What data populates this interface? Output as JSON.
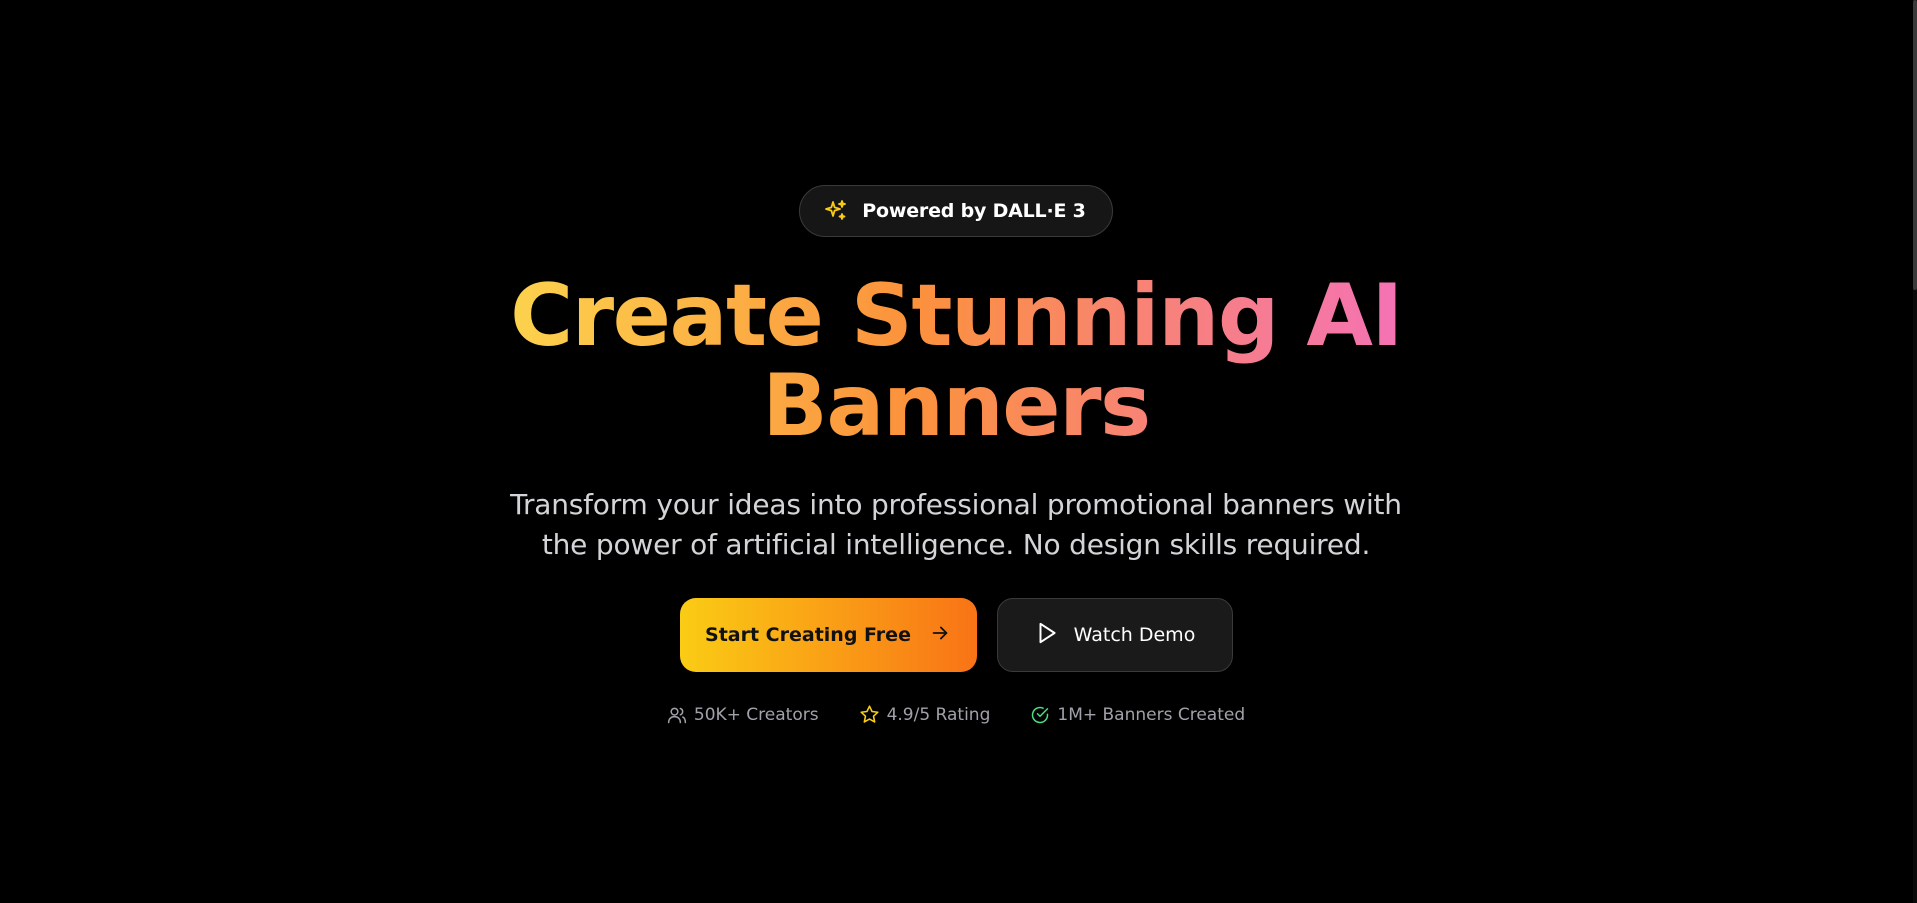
{
  "badge": {
    "icon": "sparkles-icon",
    "text": "Powered by DALL·E 3",
    "icon_color": "#facc15"
  },
  "hero": {
    "headline": "Create Stunning AI Banners",
    "subtitle": "Transform your ideas into professional promotional banners with the power of artificial intelligence. No design skills required.",
    "gradient": [
      "#fcd34d",
      "#fb923c",
      "#f472b6"
    ]
  },
  "cta": {
    "primary_label": "Start Creating Free",
    "primary_icon": "arrow-right-icon",
    "secondary_label": "Watch Demo",
    "secondary_icon": "play-icon"
  },
  "stats": [
    {
      "icon": "users-icon",
      "text": "50K+ Creators"
    },
    {
      "icon": "star-icon",
      "text": "4.9/5 Rating"
    },
    {
      "icon": "check-circle-icon",
      "text": "1M+ Banners Created"
    }
  ],
  "colors": {
    "background": "#000000",
    "accent_start": "#facc15",
    "accent_end": "#f97316"
  }
}
